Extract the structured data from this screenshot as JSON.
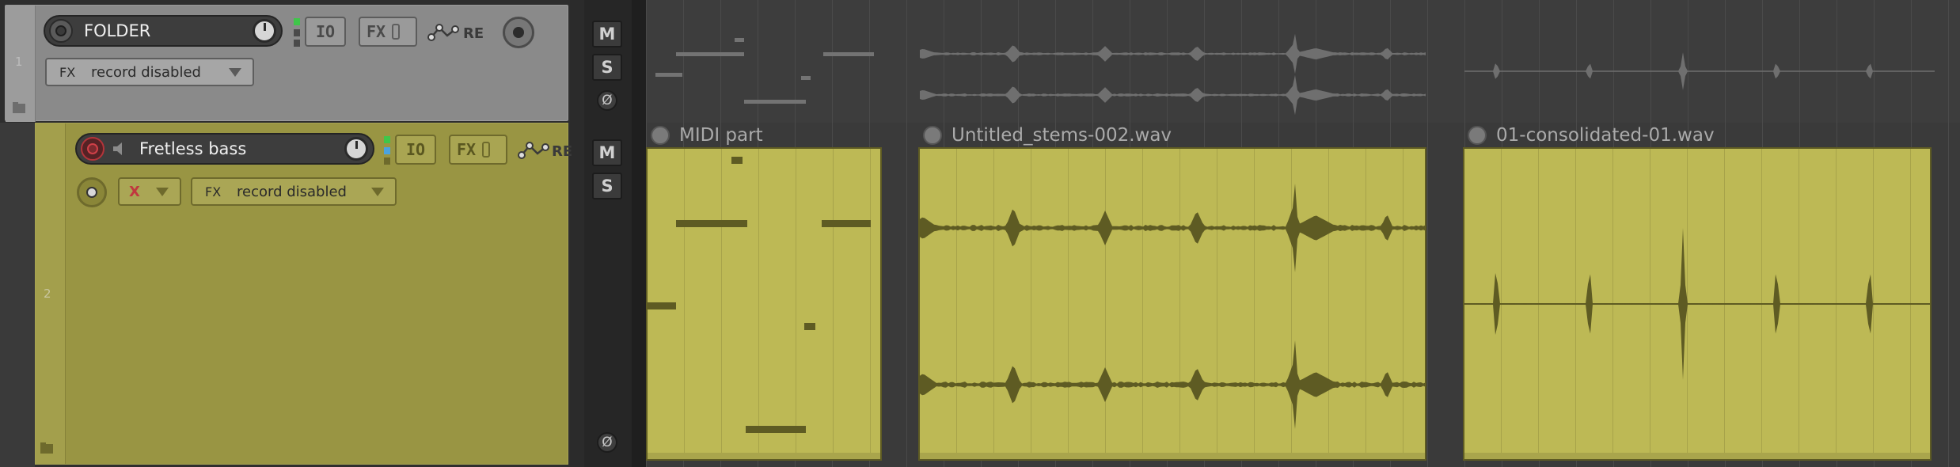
{
  "tracks": [
    {
      "number": "1",
      "name": "FOLDER",
      "io_label": "IO",
      "fx_label": "FX",
      "env_label": "RE",
      "fx_dropdown_prefix": "FX",
      "record_mode": "record disabled",
      "color": "#8a8a8a"
    },
    {
      "number": "2",
      "name": "Fretless bass",
      "io_label": "IO",
      "fx_label": "FX",
      "env_label": "RE",
      "fx_dropdown_prefix": "FX",
      "record_mode": "record disabled",
      "input_select": "X",
      "color": "#999543"
    }
  ],
  "mixer_strip": {
    "mute_label": "M",
    "solo_label": "S",
    "phase_label": "Ø"
  },
  "items": [
    {
      "name": "MIDI part",
      "type": "midi"
    },
    {
      "name": "Untitled_stems-002.wav",
      "type": "audio"
    },
    {
      "name": "01-consolidated-01.wav",
      "type": "audio"
    }
  ],
  "colors": {
    "track2_color": "#999543",
    "item_color": "#bdb955",
    "waveform": "#5e5b23",
    "rec_arm": "#c0383f"
  }
}
